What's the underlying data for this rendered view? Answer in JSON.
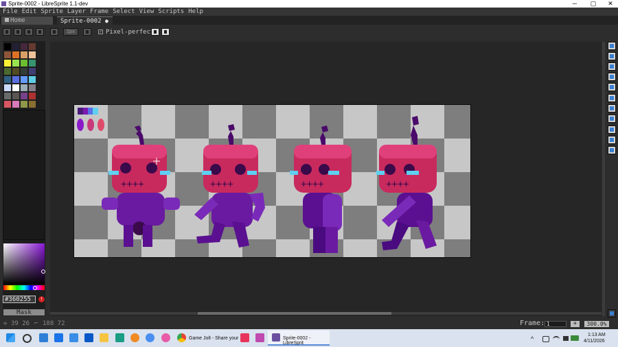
{
  "window": {
    "title": "Sprite-0002 - LibreSprite 1.1-dev",
    "controls": [
      "─",
      "▢",
      "✕"
    ]
  },
  "menu": [
    "File",
    "Edit",
    "Sprite",
    "Layer",
    "Frame",
    "Select",
    "View",
    "Scripts",
    "Help"
  ],
  "tabs": [
    {
      "label": "Home",
      "icon": "home-icon"
    },
    {
      "label": "Sprite-0002",
      "modified_icon": "●"
    }
  ],
  "context_bar": {
    "brush_size_label": "1px",
    "pixel_perfect_label": "Pixel-perfect",
    "pixel_perfect_checked": true
  },
  "palette": {
    "colors": [
      "#000000",
      "#222034",
      "#45283c",
      "#663931",
      "#8f563b",
      "#df7126",
      "#d9a066",
      "#eec39a",
      "#fbf236",
      "#99e550",
      "#6abe30",
      "#37946e",
      "#4b692f",
      "#524b24",
      "#323c39",
      "#3f3f74",
      "#306082",
      "#5b6ee1",
      "#639bff",
      "#5fcde4",
      "#cbdbfc",
      "#ffffff",
      "#9badb7",
      "#847e87",
      "#696a6a",
      "#595652",
      "#76428a",
      "#ac3232",
      "#d95763",
      "#d77bba",
      "#8f974a",
      "#8a6f30"
    ]
  },
  "color": {
    "hex_value": "#360255",
    "warning_icon": "!"
  },
  "mask_button": "Mask",
  "status": {
    "cursor_pos": "39 26",
    "selection_size": "188 72",
    "frame_label": "Frame:",
    "frame_value": "1",
    "zoom": "300.0%",
    "add_icon": "+"
  },
  "taskbar": {
    "items": [
      {
        "label": "Game Jolt - Share your"
      },
      {
        "label": "Sprite-0002 - LibreSprit"
      }
    ],
    "time": "1:13 AM",
    "date": "4/11/2026",
    "chevron": "^"
  }
}
